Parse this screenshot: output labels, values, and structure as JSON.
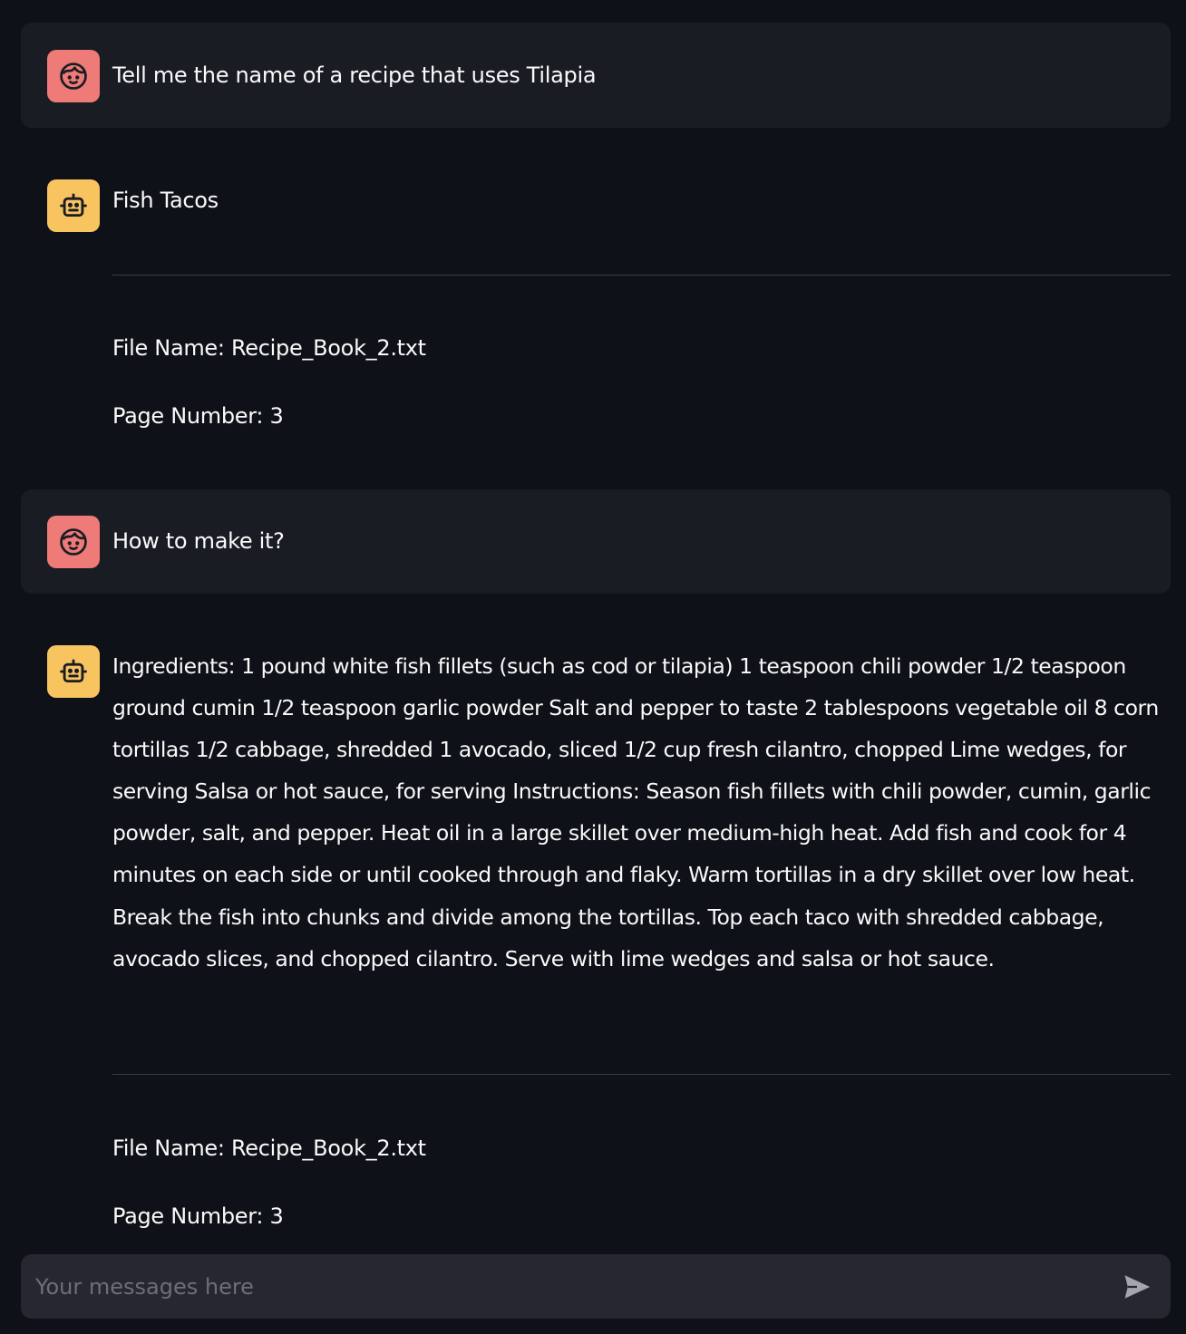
{
  "messages": [
    {
      "role": "user",
      "avatar_icon": "user-face-icon",
      "text": "Tell me the name of a recipe that uses Tilapia"
    },
    {
      "role": "assistant",
      "avatar_icon": "robot-icon",
      "text": "Fish Tacos",
      "file_name": "File Name: Recipe_Book_2.txt",
      "page_number": "Page Number: 3"
    },
    {
      "role": "user",
      "avatar_icon": "user-face-icon",
      "text": "How to make it?"
    },
    {
      "role": "assistant",
      "avatar_icon": "robot-icon",
      "text": "Ingredients: 1 pound white fish fillets (such as cod or tilapia) 1 teaspoon chili powder 1/2 teaspoon ground cumin 1/2 teaspoon garlic powder Salt and pepper to taste 2 tablespoons vegetable oil 8 corn tortillas 1/2 cabbage, shredded 1 avocado, sliced 1/2 cup fresh cilantro, chopped Lime wedges, for serving Salsa or hot sauce, for serving Instructions: Season fish fillets with chili powder, cumin, garlic powder, salt, and pepper. Heat oil in a large skillet over medium-high heat. Add fish and cook for 4 minutes on each side or until cooked through and flaky. Warm tortillas in a dry skillet over low heat. Break the fish into chunks and divide among the tortillas. Top each taco with shredded cabbage, avocado slices, and chopped cilantro. Serve with lime wedges and salsa or hot sauce.",
      "file_name": "File Name: Recipe_Book_2.txt",
      "page_number": "Page Number: 3"
    }
  ],
  "input": {
    "placeholder": "Your messages here",
    "value": ""
  },
  "colors": {
    "background": "#0e1117",
    "user_bubble": "#1a1c24",
    "user_avatar": "#ee7b78",
    "bot_avatar": "#f8c45f",
    "input_bg": "#262730",
    "text": "#fafafa"
  },
  "icons": {
    "send": "send-arrow-icon"
  }
}
